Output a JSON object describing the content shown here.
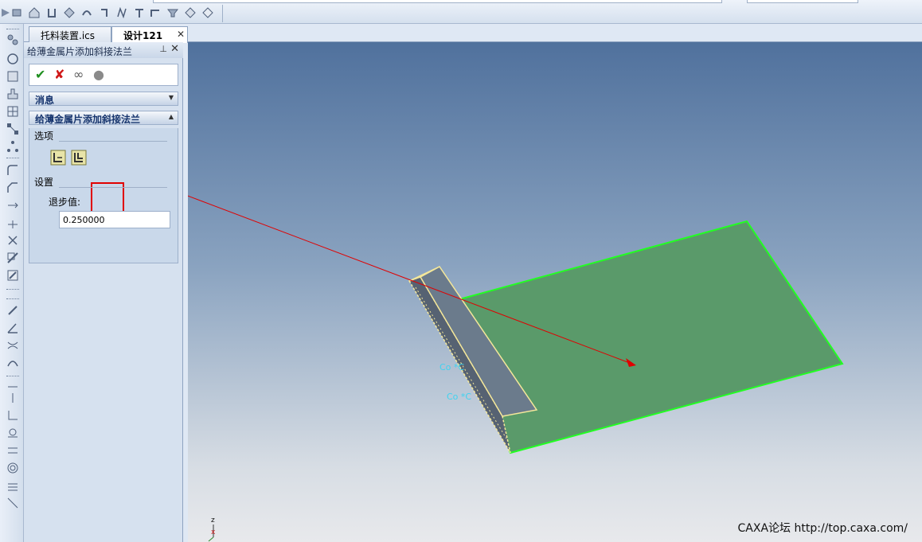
{
  "tabs": [
    {
      "label": "托料装置.ics",
      "active": false
    },
    {
      "label": "设计121",
      "active": true,
      "close": "✕"
    }
  ],
  "panel": {
    "title": "给薄金属片添加斜接法兰",
    "pin": "⊥",
    "close": "✕",
    "actions": {
      "ok": "✔",
      "cancel": "✘",
      "preview": "∞",
      "stop": "●"
    },
    "message_section": "消息",
    "main_section": "给薄金属片添加斜接法兰",
    "options_label": "选项",
    "settings_label": "设置",
    "step_label": "退步值:",
    "step_value": "0.250000"
  },
  "viewport": {
    "watermark": "CAXA论坛 http://top.caxa.com/",
    "axis_z": "z",
    "axis_x": "x",
    "annotation_1": "Co *C",
    "annotation_2": "Co *C"
  },
  "colors": {
    "plate_fill": "#5a9a6a",
    "plate_edge": "#22ff22",
    "flange_edge": "#f4e79a",
    "arrow": "#e00000",
    "annotation": "#3fd3f0"
  }
}
